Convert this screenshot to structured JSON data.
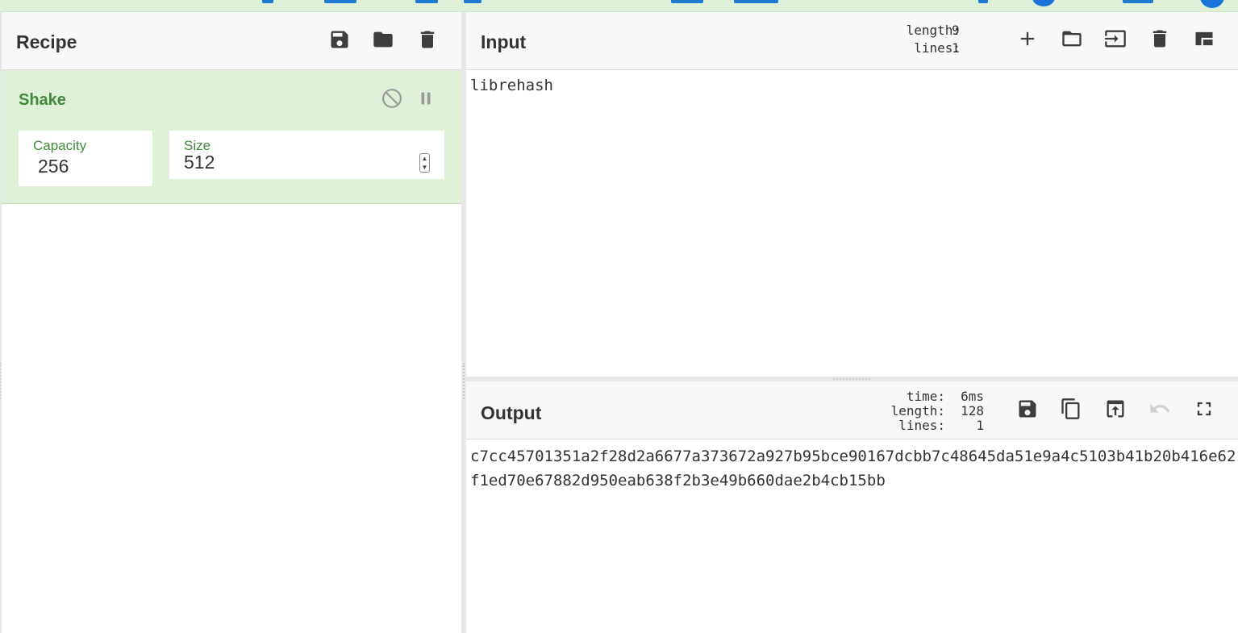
{
  "recipe": {
    "title": "Recipe",
    "operation": {
      "name": "Shake",
      "capacity_label": "Capacity",
      "capacity_value": "256",
      "size_label": "Size",
      "size_value": "512"
    }
  },
  "input": {
    "title": "Input",
    "length_label": "length:",
    "length_value": "9",
    "lines_label": "lines:",
    "lines_value": "1",
    "text": "librehash"
  },
  "output": {
    "title": "Output",
    "time_label": "time:",
    "time_value": "6ms",
    "length_label": "length:",
    "length_value": "128",
    "lines_label": "lines:",
    "lines_value": "1",
    "text": "c7cc45701351a2f28d2a6677a373672a927b95bce90167dcbb7c48645da51e9a4c5103b41b20b416e62f1ed70e67882d950eab638f2b3e49b660dae2b4cb15bb"
  },
  "colors": {
    "op_background": "#dff0d8",
    "op_label": "#3f8b3a",
    "accent_blue": "#1a73d8"
  }
}
